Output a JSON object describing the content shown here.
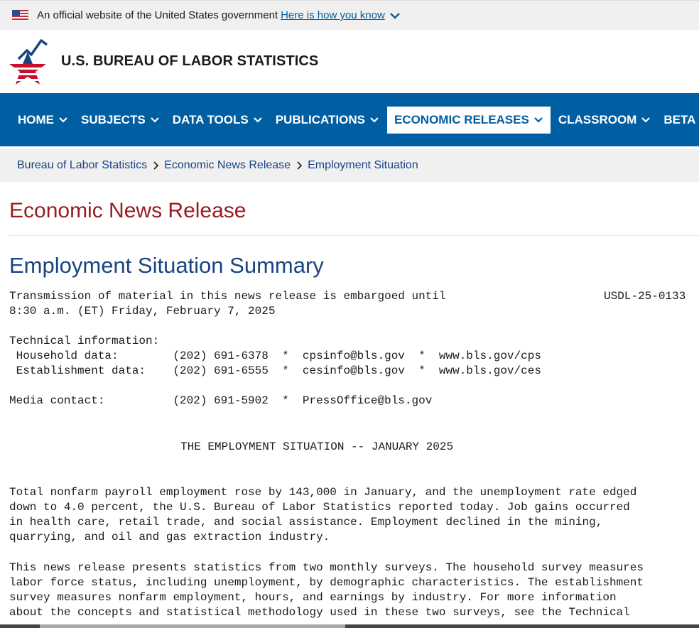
{
  "gov_banner": {
    "text": "An official website of the United States government",
    "link": "Here is how you know",
    "flag_icon": "us-flag-icon",
    "expand_icon": "chevron-down-icon"
  },
  "header": {
    "site_title": "U.S. BUREAU OF LABOR STATISTICS",
    "logo_icon": "bls-star-logo"
  },
  "nav": {
    "items": [
      {
        "label": "HOME"
      },
      {
        "label": "SUBJECTS"
      },
      {
        "label": "DATA TOOLS"
      },
      {
        "label": "PUBLICATIONS"
      },
      {
        "label": "ECONOMIC RELEASES",
        "active": true
      },
      {
        "label": "CLASSROOM"
      },
      {
        "label": "BETA"
      }
    ]
  },
  "breadcrumb": [
    "Bureau of Labor Statistics",
    "Economic News Release",
    "Employment Situation"
  ],
  "page_heading": "Economic News Release",
  "release_title": "Employment Situation Summary",
  "release": {
    "embargo_line1": "Transmission of material in this news release is embargoed until",
    "release_id": "USDL-25-0133",
    "embargo_line2": "8:30 a.m. (ET) Friday, February 7, 2025",
    "technical_label": "Technical information:",
    "household_line": " Household data:        (202) 691-6378  *  cpsinfo@bls.gov  *  www.bls.gov/cps",
    "establishment_line": " Establishment data:    (202) 691-6555  *  cesinfo@bls.gov  *  www.bls.gov/ces",
    "media_line": "Media contact:          (202) 691-5902  *  PressOffice@bls.gov",
    "section_title": "THE EMPLOYMENT SITUATION -- JANUARY 2025",
    "para1": "Total nonfarm payroll employment rose by 143,000 in January, and the unemployment rate edged\ndown to 4.0 percent, the U.S. Bureau of Labor Statistics reported today. Job gains occurred\nin health care, retail trade, and social assistance. Employment declined in the mining,\nquarrying, and oil and gas extraction industry.",
    "para2": "This news release presents statistics from two monthly surveys. The household survey measures\nlabor force status, including unemployment, by demographic characteristics. The establishment\nsurvey measures nonfarm employment, hours, and earnings by industry. For more information\nabout the concepts and statistical methodology used in these two surveys, see the Technical"
  },
  "colors": {
    "nav_blue": "#005ea2",
    "heading_red": "#981b1e",
    "title_navy": "#1a4480"
  }
}
